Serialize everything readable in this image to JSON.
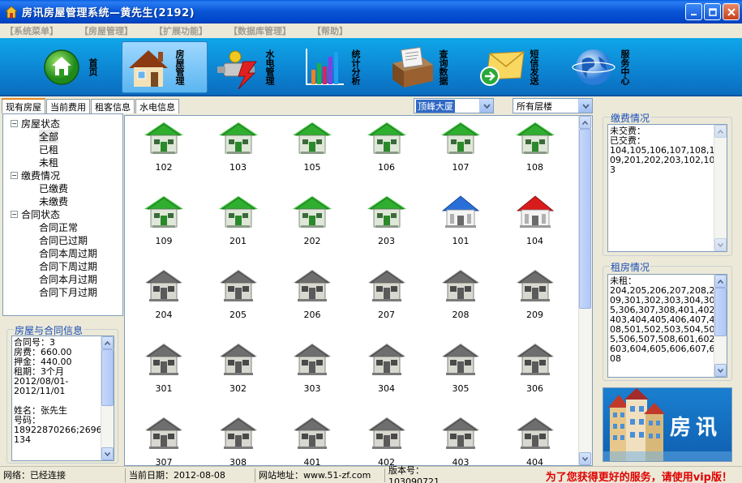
{
  "window": {
    "title": "房讯房屋管理系统—黄先生(2192)"
  },
  "menu": [
    "【系统菜单】",
    "【房屋管理】",
    "【扩展功能】",
    "【数据库管理】",
    "【帮助】"
  ],
  "toolbar": [
    {
      "label": "首页",
      "icon": "home-icon"
    },
    {
      "label": "房屋管理",
      "icon": "house-icon"
    },
    {
      "label": "水电管理",
      "icon": "utility-icon"
    },
    {
      "label": "统计分析",
      "icon": "chart-icon"
    },
    {
      "label": "查询数据",
      "icon": "database-icon"
    },
    {
      "label": "短信发送",
      "icon": "sms-icon"
    },
    {
      "label": "服务中心",
      "icon": "globe-icon"
    }
  ],
  "tabs": [
    "现有房屋",
    "当前费用",
    "租客信息",
    "水电信息"
  ],
  "building_select": "顶峰大厦",
  "floor_select": "所有层楼",
  "tree": [
    {
      "label": "房屋状态",
      "children": [
        "全部",
        "已租",
        "未租"
      ]
    },
    {
      "label": "缴费情况",
      "children": [
        "已缴费",
        "未缴费"
      ]
    },
    {
      "label": "合同状态",
      "children": [
        "合同正常",
        "合同已过期",
        "合同本周过期",
        "合同下周过期",
        "合同本月过期",
        "合同下月过期"
      ]
    }
  ],
  "contract_info": {
    "title": "房屋与合同信息",
    "lines": [
      "合同号：3",
      "房费：660.00",
      "押金：440.00",
      "租期：3个月",
      "2012/08/01-",
      "2012/11/01",
      "",
      "姓名：张先生",
      "号码：",
      "18922870266;26960",
      "134"
    ]
  },
  "rooms": [
    {
      "no": "102",
      "status": "green"
    },
    {
      "no": "103",
      "status": "green"
    },
    {
      "no": "105",
      "status": "green"
    },
    {
      "no": "106",
      "status": "green"
    },
    {
      "no": "107",
      "status": "green"
    },
    {
      "no": "108",
      "status": "green"
    },
    {
      "no": "109",
      "status": "green"
    },
    {
      "no": "201",
      "status": "green"
    },
    {
      "no": "202",
      "status": "green"
    },
    {
      "no": "203",
      "status": "green"
    },
    {
      "no": "101",
      "status": "blue"
    },
    {
      "no": "104",
      "status": "red"
    },
    {
      "no": "204",
      "status": "gray"
    },
    {
      "no": "205",
      "status": "gray"
    },
    {
      "no": "206",
      "status": "gray"
    },
    {
      "no": "207",
      "status": "gray"
    },
    {
      "no": "208",
      "status": "gray"
    },
    {
      "no": "209",
      "status": "gray"
    },
    {
      "no": "301",
      "status": "gray"
    },
    {
      "no": "302",
      "status": "gray"
    },
    {
      "no": "303",
      "status": "gray"
    },
    {
      "no": "304",
      "status": "gray"
    },
    {
      "no": "305",
      "status": "gray"
    },
    {
      "no": "306",
      "status": "gray"
    },
    {
      "no": "307",
      "status": "gray"
    },
    {
      "no": "308",
      "status": "gray"
    },
    {
      "no": "401",
      "status": "gray"
    },
    {
      "no": "402",
      "status": "gray"
    },
    {
      "no": "403",
      "status": "gray"
    },
    {
      "no": "404",
      "status": "gray"
    }
  ],
  "payment": {
    "title": "缴费情况",
    "lines": [
      "未交费：",
      "已交费：",
      "104,105,106,107,108,1",
      "09,201,202,203,102,10",
      "3"
    ]
  },
  "rental": {
    "title": "租房情况",
    "lines": [
      "未租：",
      "204,205,206,207,208,2",
      "09,301,302,303,304,30",
      "5,306,307,308,401,402,",
      "403,404,405,406,407,4",
      "08,501,502,503,504,50",
      "5,506,507,508,601,602,",
      "603,604,605,606,607,6",
      "08"
    ]
  },
  "banner": {
    "text": "房讯"
  },
  "status": {
    "network": "网络：已经连接",
    "date": "当前日期：2012-08-08",
    "website": "网站地址：www.51-zf.com",
    "version": "版本号：103090721",
    "promo": "为了您获得更好的服务，请使用vip版！"
  },
  "colors": {
    "green": "#2fae2f",
    "blue": "#2a6ed8",
    "red": "#d81c1c",
    "gray": "#6e6e6e"
  }
}
